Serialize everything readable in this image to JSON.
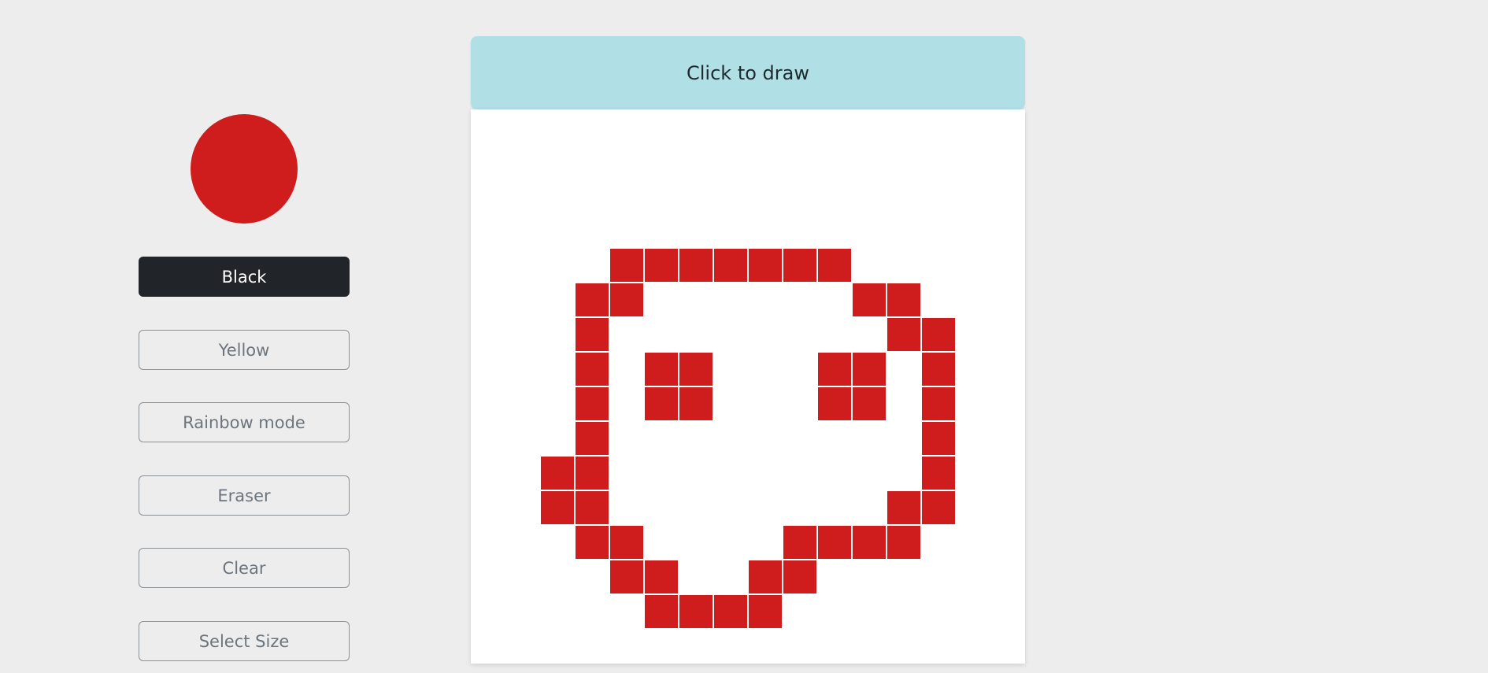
{
  "colors": {
    "current": "#cf1c1c",
    "header_bg": "#b0dfe5",
    "board_bg": "#ffffff"
  },
  "controls": {
    "buttons": [
      {
        "id": "black",
        "label": "Black",
        "active": true
      },
      {
        "id": "yellow",
        "label": "Yellow",
        "active": false
      },
      {
        "id": "rainbow",
        "label": "Rainbow mode",
        "active": false
      },
      {
        "id": "eraser",
        "label": "Eraser",
        "active": false
      },
      {
        "id": "clear",
        "label": "Clear",
        "active": false
      },
      {
        "id": "size",
        "label": "Select Size",
        "active": false
      }
    ]
  },
  "board": {
    "header_label": "Click to draw",
    "grid_size": 16,
    "filled_cells": [
      [
        4,
        4
      ],
      [
        4,
        5
      ],
      [
        4,
        6
      ],
      [
        4,
        7
      ],
      [
        4,
        8
      ],
      [
        4,
        9
      ],
      [
        4,
        10
      ],
      [
        5,
        3
      ],
      [
        5,
        4
      ],
      [
        5,
        11
      ],
      [
        5,
        12
      ],
      [
        6,
        3
      ],
      [
        6,
        12
      ],
      [
        6,
        13
      ],
      [
        7,
        3
      ],
      [
        7,
        5
      ],
      [
        7,
        6
      ],
      [
        7,
        10
      ],
      [
        7,
        11
      ],
      [
        7,
        13
      ],
      [
        8,
        3
      ],
      [
        8,
        5
      ],
      [
        8,
        6
      ],
      [
        8,
        10
      ],
      [
        8,
        11
      ],
      [
        8,
        13
      ],
      [
        9,
        3
      ],
      [
        9,
        13
      ],
      [
        10,
        2
      ],
      [
        10,
        3
      ],
      [
        10,
        13
      ],
      [
        11,
        2
      ],
      [
        11,
        3
      ],
      [
        11,
        12
      ],
      [
        11,
        13
      ],
      [
        12,
        3
      ],
      [
        12,
        4
      ],
      [
        12,
        9
      ],
      [
        12,
        10
      ],
      [
        12,
        11
      ],
      [
        12,
        12
      ],
      [
        13,
        4
      ],
      [
        13,
        5
      ],
      [
        13,
        8
      ],
      [
        13,
        9
      ],
      [
        14,
        5
      ],
      [
        14,
        6
      ],
      [
        14,
        7
      ],
      [
        14,
        8
      ]
    ]
  }
}
